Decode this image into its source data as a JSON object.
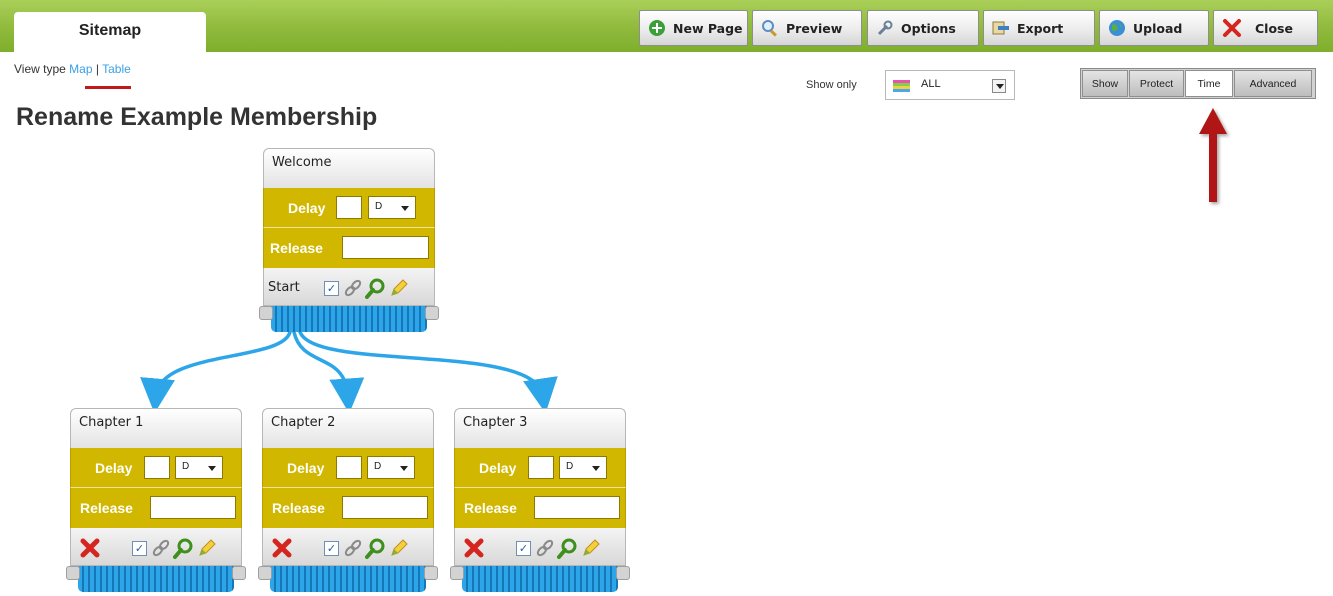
{
  "toolbar": {
    "tab_label": "Sitemap",
    "buttons": {
      "new_page": "New Page",
      "preview": "Preview",
      "options": "Options",
      "export": "Export",
      "upload": "Upload",
      "close": "Close"
    }
  },
  "view_type": {
    "label": "View type",
    "options": [
      "Map",
      "Table"
    ],
    "separator": "|",
    "selected": "Map"
  },
  "page_title": "Rename Example Membership",
  "show_only": {
    "label": "Show only",
    "value": "ALL"
  },
  "modes": {
    "items": [
      "Show",
      "Protect",
      "Time",
      "Advanced"
    ],
    "active": "Time"
  },
  "nodes": [
    {
      "title": "Welcome",
      "delay_label": "Delay",
      "delay_unit": "D",
      "release_label": "Release",
      "footer_label": "Start"
    },
    {
      "title": "Chapter 1",
      "delay_label": "Delay",
      "delay_unit": "D",
      "release_label": "Release"
    },
    {
      "title": "Chapter 2",
      "delay_label": "Delay",
      "delay_unit": "D",
      "release_label": "Release"
    },
    {
      "title": "Chapter 3",
      "delay_label": "Delay",
      "delay_unit": "D",
      "release_label": "Release"
    }
  ],
  "colors": {
    "topbar_green": "#8fba3c",
    "node_yellow": "#d2b700",
    "connector_blue": "#2ca6e8",
    "link_blue": "#3ba0e6",
    "annotation_red": "#b01818"
  },
  "icons": {
    "new_page": "plus-circle-icon",
    "preview": "magnifier-icon",
    "options": "wrench-icon",
    "export": "export-icon",
    "upload": "globe-icon",
    "close": "x-icon",
    "node_actions": [
      "checkbox-icon",
      "link-icon",
      "search-icon",
      "edit-icon"
    ],
    "delete": "delete-icon"
  }
}
